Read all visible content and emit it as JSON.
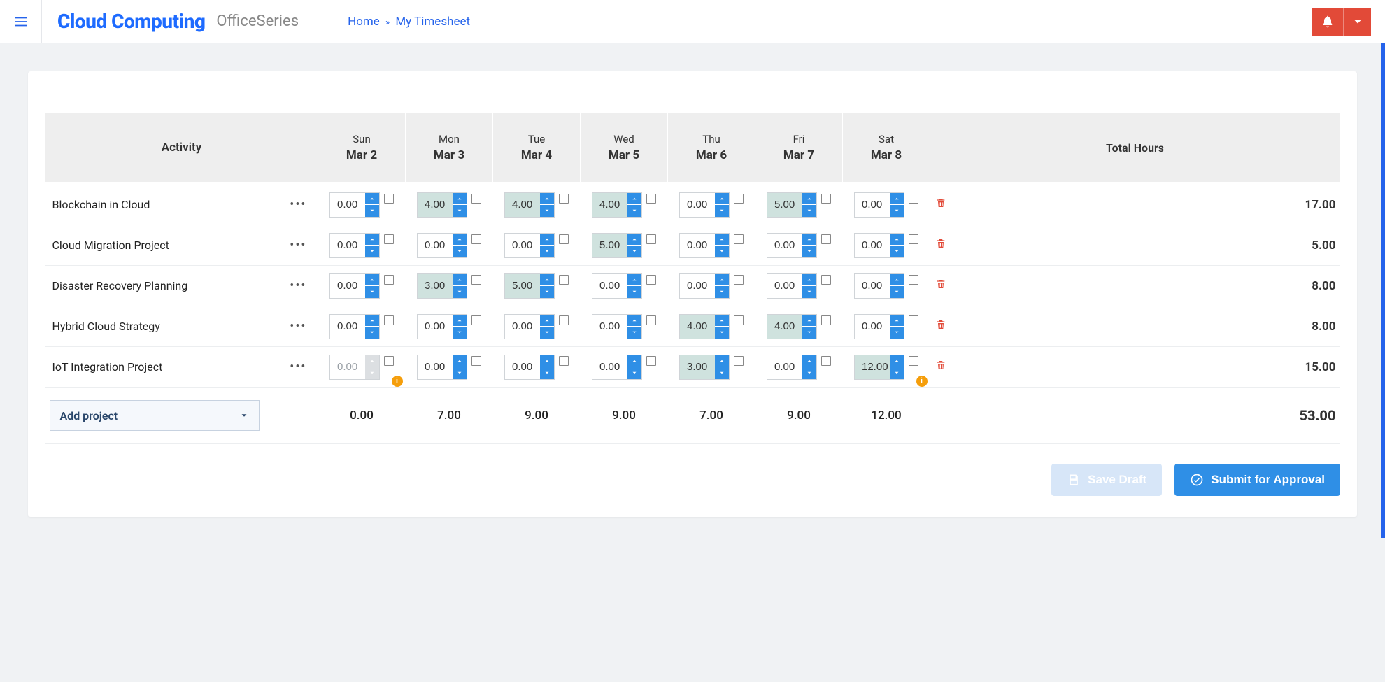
{
  "header": {
    "brand": "Cloud Computing",
    "subbrand": "OfficeSeries",
    "breadcrumb": {
      "home": "Home",
      "current": "My Timesheet"
    }
  },
  "table": {
    "activity_header": "Activity",
    "total_header": "Total Hours",
    "days": [
      {
        "dayname": "Sun",
        "date": "Mar 2"
      },
      {
        "dayname": "Mon",
        "date": "Mar 3"
      },
      {
        "dayname": "Tue",
        "date": "Mar 4"
      },
      {
        "dayname": "Wed",
        "date": "Mar 5"
      },
      {
        "dayname": "Thu",
        "date": "Mar 6"
      },
      {
        "dayname": "Fri",
        "date": "Mar 7"
      },
      {
        "dayname": "Sat",
        "date": "Mar 8"
      }
    ],
    "rows": [
      {
        "name": "Blockchain in Cloud",
        "cells": [
          {
            "value": "0.00",
            "filled": false
          },
          {
            "value": "4.00",
            "filled": true
          },
          {
            "value": "4.00",
            "filled": true
          },
          {
            "value": "4.00",
            "filled": true
          },
          {
            "value": "0.00",
            "filled": false
          },
          {
            "value": "5.00",
            "filled": true
          },
          {
            "value": "0.00",
            "filled": false
          }
        ],
        "total": "17.00"
      },
      {
        "name": "Cloud Migration Project",
        "cells": [
          {
            "value": "0.00",
            "filled": false
          },
          {
            "value": "0.00",
            "filled": false
          },
          {
            "value": "0.00",
            "filled": false
          },
          {
            "value": "5.00",
            "filled": true
          },
          {
            "value": "0.00",
            "filled": false
          },
          {
            "value": "0.00",
            "filled": false
          },
          {
            "value": "0.00",
            "filled": false
          }
        ],
        "total": "5.00"
      },
      {
        "name": "Disaster Recovery Planning",
        "cells": [
          {
            "value": "0.00",
            "filled": false
          },
          {
            "value": "3.00",
            "filled": true
          },
          {
            "value": "5.00",
            "filled": true
          },
          {
            "value": "0.00",
            "filled": false
          },
          {
            "value": "0.00",
            "filled": false
          },
          {
            "value": "0.00",
            "filled": false
          },
          {
            "value": "0.00",
            "filled": false
          }
        ],
        "total": "8.00"
      },
      {
        "name": "Hybrid Cloud Strategy",
        "cells": [
          {
            "value": "0.00",
            "filled": false
          },
          {
            "value": "0.00",
            "filled": false
          },
          {
            "value": "0.00",
            "filled": false
          },
          {
            "value": "0.00",
            "filled": false
          },
          {
            "value": "4.00",
            "filled": true
          },
          {
            "value": "4.00",
            "filled": true
          },
          {
            "value": "0.00",
            "filled": false
          }
        ],
        "total": "8.00"
      },
      {
        "name": "IoT Integration Project",
        "cells": [
          {
            "value": "0.00",
            "filled": false,
            "disabled": true,
            "warn": true
          },
          {
            "value": "0.00",
            "filled": false
          },
          {
            "value": "0.00",
            "filled": false
          },
          {
            "value": "0.00",
            "filled": false
          },
          {
            "value": "3.00",
            "filled": true
          },
          {
            "value": "0.00",
            "filled": false
          },
          {
            "value": "12.00",
            "filled": true,
            "warn": true
          }
        ],
        "total": "15.00"
      }
    ],
    "day_totals": [
      "0.00",
      "7.00",
      "9.00",
      "9.00",
      "7.00",
      "9.00",
      "12.00"
    ],
    "grand_total": "53.00",
    "add_project_label": "Add project"
  },
  "actions": {
    "save_draft": "Save Draft",
    "submit": "Submit for Approval"
  }
}
